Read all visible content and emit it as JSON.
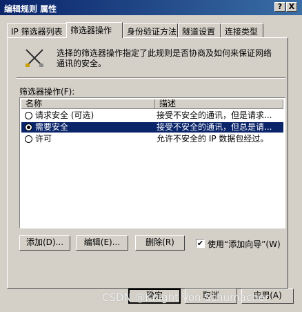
{
  "window": {
    "title": "编辑规则 属性",
    "help_glyph": "?",
    "close_glyph": "X"
  },
  "tabs": [
    {
      "label": "IP 筛选器列表"
    },
    {
      "label": "筛选器操作"
    },
    {
      "label": "身份验证方法"
    },
    {
      "label": "隧道设置"
    },
    {
      "label": "连接类型"
    }
  ],
  "description": "选择的筛选器操作指定了此规则是否协商及如何来保证网络通讯的安全。",
  "icon": "filter-action-icon",
  "list": {
    "label": "筛选器操作(F):",
    "columns": [
      "名称",
      "描述"
    ],
    "rows": [
      {
        "name": "请求安全 (可选)",
        "desc": "接受不安全的通讯，但是请求...",
        "selected": false
      },
      {
        "name": "需要安全",
        "desc": "接受不安全的通讯，但总是请...",
        "selected": true
      },
      {
        "name": "许可",
        "desc": "允许不安全的 IP 数据包经过。",
        "selected": false
      }
    ]
  },
  "buttons": {
    "add": "添加(D)...",
    "edit": "编辑(E)...",
    "remove": "删除(R)",
    "ok": "确定",
    "cancel": "取消",
    "apply": "应用(A)"
  },
  "wizard": {
    "label": "使用“添加向导”(W)",
    "checked": true,
    "mark": "✔"
  },
  "watermark": "CSDN @Knight Von Schumacher",
  "colors": {
    "title_bar": "#0a246a",
    "selection": "#0a246a",
    "face": "#d4d0c8"
  }
}
